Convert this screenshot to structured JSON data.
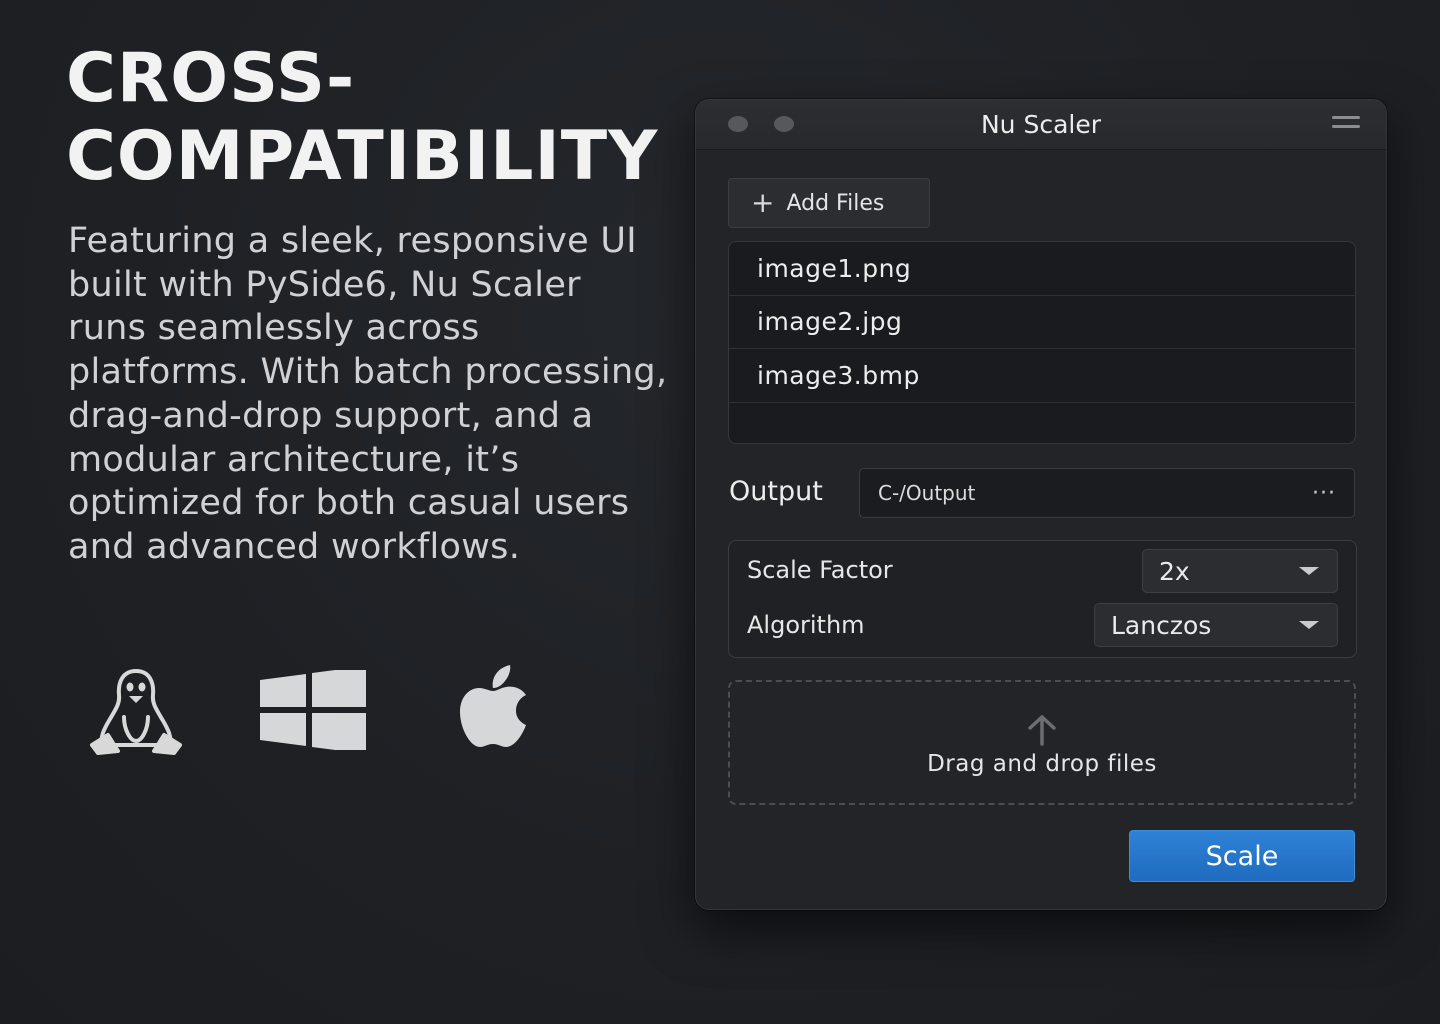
{
  "hero": {
    "title": "CROSS-\nCOMPATIBILITY",
    "description": "Featuring a sleek, responsive UI built with PySide6, Nu Scaler runs seamlessly across platforms. With batch processing, drag-and-drop support, and a modular architecture, it’s optimized for both casual users and advanced workflows.",
    "platform_icons": [
      "linux-tux-icon",
      "windows-logo-icon",
      "apple-logo-icon"
    ]
  },
  "window": {
    "title": "Nu Scaler",
    "add_files_label": "Add Files",
    "files": [
      "image1.png",
      "image2.jpg",
      "image3.bmp"
    ],
    "output_label": "Output",
    "output_value": "C-/Output",
    "browse_label": "···",
    "scale_factor_label": "Scale Factor",
    "scale_factor_value": "2x",
    "algorithm_label": "Algorithm",
    "algorithm_value": "Lanczos",
    "drop_text": "Drag and drop files",
    "scale_button_label": "Scale"
  },
  "colors": {
    "background": "#1e2024",
    "window": "#222427",
    "accent": "#2a78cf"
  }
}
